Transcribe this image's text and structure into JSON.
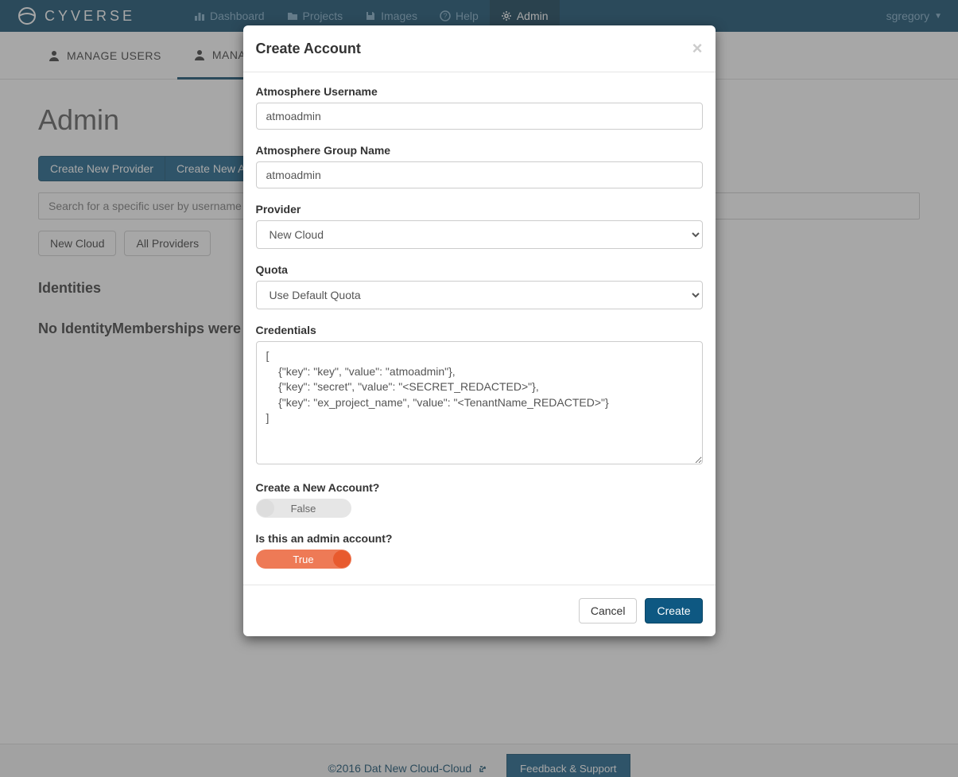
{
  "brand": "CYVERSE",
  "nav": {
    "dashboard": "Dashboard",
    "projects": "Projects",
    "images": "Images",
    "help": "Help",
    "admin": "Admin",
    "user": "sgregory"
  },
  "subnav": {
    "manage_users": "MANAGE USERS",
    "manage_second": "MANAGE"
  },
  "page": {
    "title": "Admin",
    "create_provider_btn": "Create New Provider",
    "create_account_btn": "Create New Acco",
    "search_placeholder": "Search for a specific user by username",
    "tag_new_cloud": "New Cloud",
    "tag_all_providers": "All Providers",
    "identities_heading": "Identities",
    "empty_msg": "No IdentityMemberships were"
  },
  "modal": {
    "title": "Create Account",
    "username_label": "Atmosphere Username",
    "username_value": "atmoadmin",
    "groupname_label": "Atmosphere Group Name",
    "groupname_value": "atmoadmin",
    "provider_label": "Provider",
    "provider_value": "New Cloud",
    "quota_label": "Quota",
    "quota_value": "Use Default Quota",
    "credentials_label": "Credentials",
    "credentials_value": "[\n    {\"key\": \"key\", \"value\": \"atmoadmin\"},\n    {\"key\": \"secret\", \"value\": \"<SECRET_REDACTED>\"},\n    {\"key\": \"ex_project_name\", \"value\": \"<TenantName_REDACTED>\"}\n]",
    "create_new_label": "Create a New Account?",
    "create_new_value": "False",
    "admin_account_label": "Is this an admin account?",
    "admin_account_value": "True",
    "cancel_btn": "Cancel",
    "create_btn": "Create"
  },
  "footer": {
    "copyright": "©2016 Dat New Cloud-Cloud",
    "feedback_btn": "Feedback & Support"
  }
}
